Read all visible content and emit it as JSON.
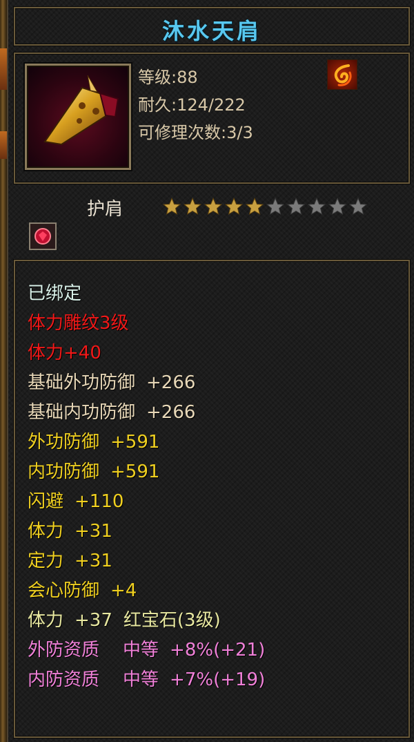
{
  "item": {
    "name": "沐水天肩",
    "type": "护肩",
    "level": "等级:88",
    "durability": "耐久:124/222",
    "repair": "可修理次数:3/3",
    "stars_filled": 5,
    "stars_total": 10
  },
  "colors": {
    "title": "#58c8f0",
    "star_gold": "#c8a040",
    "star_empty": "#7a7a7a"
  },
  "icons": {
    "item_icon": "golden-shoulder-guard-icon",
    "badge": "fire-swirl-icon",
    "gem": "red-gem-icon"
  },
  "attributes": [
    {
      "text": "已绑定"
    },
    {
      "text": "体力雕纹3级"
    },
    {
      "text": "体力+40"
    },
    {
      "label": "基础外功防御",
      "value": "+266"
    },
    {
      "label": "基础内功防御",
      "value": "+266"
    },
    {
      "label": "外功防御",
      "value": "+591"
    },
    {
      "label": "内功防御",
      "value": "+591"
    },
    {
      "label": "闪避",
      "value": "+110"
    },
    {
      "label": "体力",
      "value": "+31"
    },
    {
      "label": "定力",
      "value": "+31"
    },
    {
      "label": "会心防御",
      "value": "+4"
    },
    {
      "label": "体力",
      "value": "+37",
      "gem": "红宝石(3级)"
    },
    {
      "label": "外防资质",
      "grade": "中等",
      "value": "+8%(+21)"
    },
    {
      "label": "内防资质",
      "grade": "中等",
      "value": "+7%(+19)"
    }
  ]
}
